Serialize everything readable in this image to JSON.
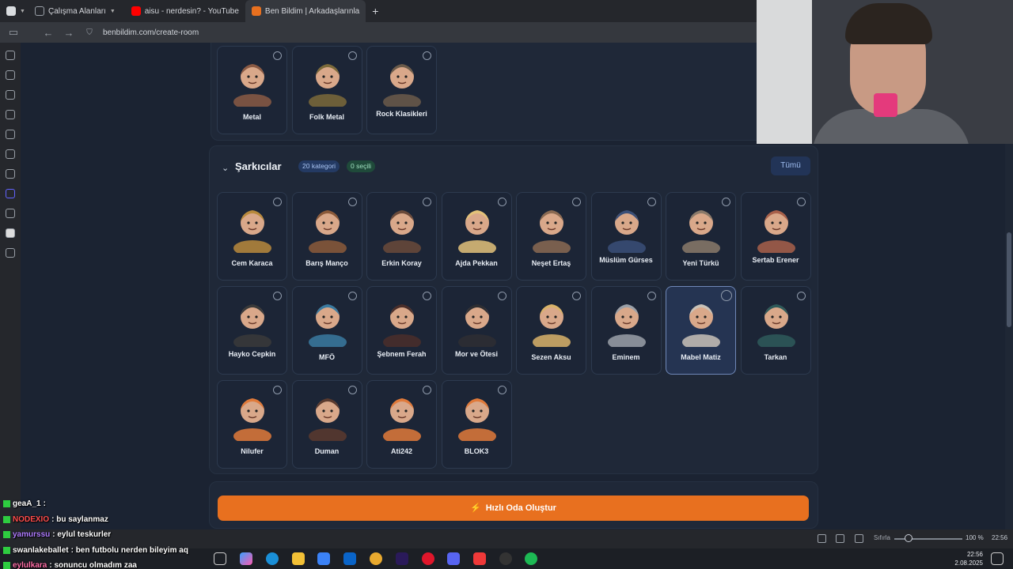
{
  "browser": {
    "tabs": [
      {
        "label": "Çalışma Alanları",
        "color": "#9aa0a8"
      },
      {
        "label": "aisu - nerdesin? - YouTube",
        "color": "#ff0000"
      },
      {
        "label": "Ben Bildim | Arkadaşlarınla",
        "color": "#e8701f"
      }
    ],
    "url": "benbildim.com/create-room"
  },
  "genres_row": [
    {
      "name": "Metal",
      "color": "#8a5a44"
    },
    {
      "name": "Folk Metal",
      "color": "#7b6a3a"
    },
    {
      "name": "Rock Klasikleri",
      "color": "#6b5b4a"
    }
  ],
  "section": {
    "title": "Şarkıcılar",
    "category_badge": "20 kategori",
    "selected_badge": "0 seçili",
    "all_button": "Tümü"
  },
  "singers": [
    {
      "name": "Cem Karaca",
      "color": "#b88a3c"
    },
    {
      "name": "Barış Manço",
      "color": "#8b5a3a"
    },
    {
      "name": "Erkin Koray",
      "color": "#6a4a3a"
    },
    {
      "name": "Ajda Pekkan",
      "color": "#e3c27a"
    },
    {
      "name": "Neşet Ertaş",
      "color": "#8a6a52"
    },
    {
      "name": "Müslüm Gürses",
      "color": "#3a4f78"
    },
    {
      "name": "Yeni Türkü",
      "color": "#8a7a6a"
    },
    {
      "name": "Sertab Erener",
      "color": "#a8604a"
    },
    {
      "name": "Hayko Cepkin",
      "color": "#3a3a3a"
    },
    {
      "name": "MFÖ",
      "color": "#3a7aa0"
    },
    {
      "name": "Şebnem Ferah",
      "color": "#4a2e2a"
    },
    {
      "name": "Mor ve Ötesi",
      "color": "#2e2e32"
    },
    {
      "name": "Sezen Aksu",
      "color": "#d9b36a"
    },
    {
      "name": "Eminem",
      "color": "#9aa0a8"
    },
    {
      "name": "Mabel Matiz",
      "color": "#c9c2b8"
    },
    {
      "name": "Tarkan",
      "color": "#2e5a5a"
    },
    {
      "name": "Nilufer",
      "color": "#e07a3a"
    },
    {
      "name": "Duman",
      "color": "#5a3a2e"
    },
    {
      "name": "Ati242",
      "color": "#e07a3a"
    },
    {
      "name": "BLOK3",
      "color": "#e07a3a"
    }
  ],
  "cta": {
    "label": "Hızlı Oda Oluştur"
  },
  "chat": [
    {
      "user": "geaA_1",
      "message": "",
      "color": "#ffffff"
    },
    {
      "user": "NODEXIO",
      "message": "bu saylanmaz",
      "color": "#ff4d4d"
    },
    {
      "user": "yamurssu",
      "message": "eylul teskurler",
      "color": "#b07cff"
    },
    {
      "user": "swanlakeballet",
      "message": "ben futbolu nerden bileyim aq",
      "color": "#ffffff"
    },
    {
      "user": "eylulkara",
      "message": "sonuncu olmadım zaa",
      "color": "#ff6fa8"
    }
  ],
  "statusbar": {
    "zoom_label": "Sıfırla",
    "zoom_value": "100 %",
    "time": "22:56"
  },
  "taskbar": {
    "time": "22:56",
    "date": "2.08.2025"
  }
}
